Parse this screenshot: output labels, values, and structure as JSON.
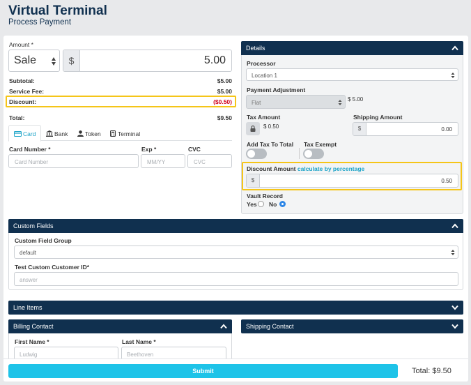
{
  "page": {
    "title": "Virtual Terminal",
    "subtitle": "Process Payment"
  },
  "amount": {
    "label": "Amount *",
    "type_value": "Sale",
    "currency": "$",
    "value": "5.00"
  },
  "summary": {
    "subtotal_label": "Subtotal:",
    "subtotal": "$5.00",
    "service_fee_label": "Service Fee:",
    "service_fee": "$5.00",
    "discount_label": "Discount:",
    "discount": "($0.50)",
    "total_label": "Total:",
    "total": "$9.50"
  },
  "payment_tabs": [
    {
      "label": "Card",
      "icon": "card-icon",
      "active": true
    },
    {
      "label": "Bank",
      "icon": "bank-icon"
    },
    {
      "label": "Token",
      "icon": "user-icon"
    },
    {
      "label": "Terminal",
      "icon": "calculator-icon"
    }
  ],
  "card_fields": {
    "card_number_label": "Card Number *",
    "card_number_placeholder": "Card Number",
    "exp_label": "Exp *",
    "exp_placeholder": "MM/YY",
    "cvc_label": "CVC",
    "cvc_placeholder": "CVC"
  },
  "details": {
    "header": "Details",
    "processor_label": "Processor",
    "processor_value": "Location 1",
    "payment_adjustment_label": "Payment Adjustment",
    "payment_adjustment_value": "Flat",
    "payment_adjustment_amount": "$ 5.00",
    "tax_amount_label": "Tax Amount",
    "tax_amount_value": "$ 0.50",
    "shipping_amount_label": "Shipping Amount",
    "shipping_currency": "$",
    "shipping_amount_value": "0.00",
    "add_tax_label": "Add Tax To Total",
    "tax_exempt_label": "Tax Exempt",
    "discount_amount_label": "Discount Amount",
    "discount_link": "calculate by percentage",
    "discount_currency": "$",
    "discount_amount_value": "0.50",
    "vault_record_label": "Vault Record",
    "vault_yes": "Yes",
    "vault_no": "No"
  },
  "custom_fields": {
    "header": "Custom Fields",
    "group_label": "Custom Field Group",
    "group_value": "default",
    "customer_id_label": "Test Custom Customer ID*",
    "customer_id_placeholder": "answer"
  },
  "line_items": {
    "header": "Line Items"
  },
  "billing": {
    "header": "Billing Contact",
    "first_name_label": "First Name *",
    "first_name_placeholder": "Ludwig",
    "last_name_label": "Last Name *",
    "last_name_placeholder": "Beethoven"
  },
  "shipping": {
    "header": "Shipping Contact"
  },
  "footer": {
    "submit_label": "Submit",
    "total_text": "Total: $9.50"
  },
  "colors": {
    "navy": "#10304f",
    "accent": "#1ec3e8",
    "highlight": "#f5c518",
    "discount_red": "#d0021b",
    "link": "#1aa3c7"
  }
}
